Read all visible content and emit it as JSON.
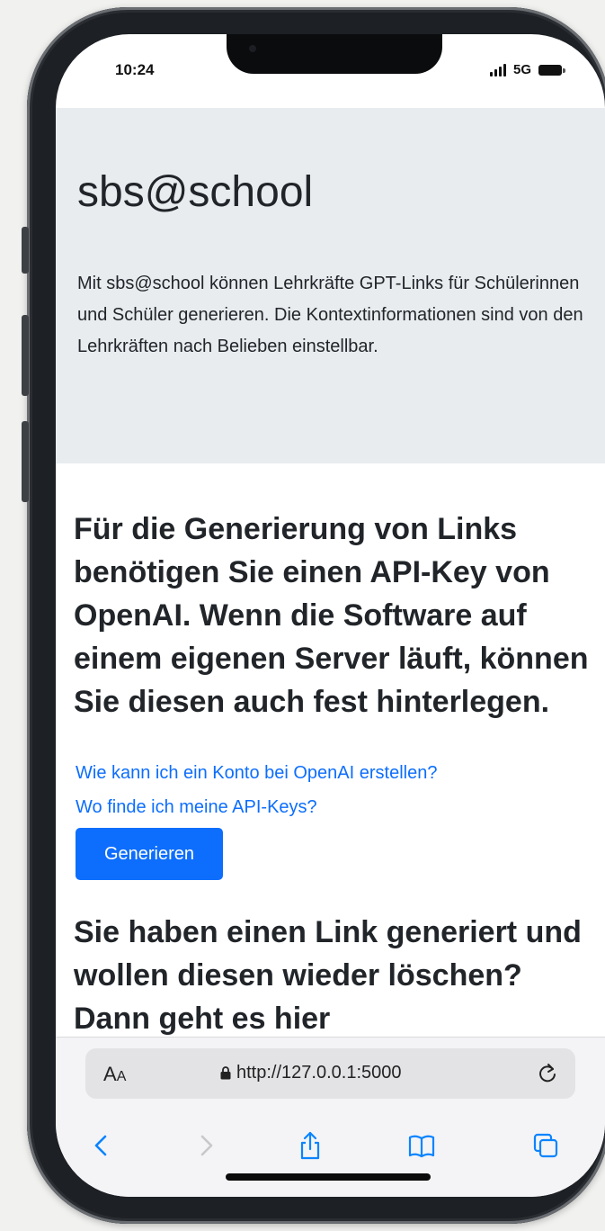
{
  "status_bar": {
    "time": "10:24",
    "network": "5G"
  },
  "hero": {
    "title": "sbs@school",
    "lead": "Mit sbs@school können Lehrkräfte GPT-Links für Schülerinnen und Schüler generieren. Die Kontextinformationen sind von den Lehrkräften nach Belieben einstellbar."
  },
  "info": {
    "heading": "Für die Generierung von Links benötigen Sie einen API-Key von OpenAI. Wenn die Software auf einem eigenen Server läuft, können Sie diesen auch fest hinterlegen.",
    "link_konto": "Wie kann ich ein Konto bei OpenAI erstellen?",
    "link_keys": "Wo finde ich meine API-Keys?",
    "generate_label": "Generieren"
  },
  "delete_section": {
    "heading": "Sie haben einen Link generiert und wollen diesen wieder löschen? Dann geht es hier"
  },
  "safari": {
    "aa_label_big": "A",
    "aa_label_small": "A",
    "url": "http://127.0.0.1:5000"
  },
  "colors": {
    "hero_bg": "#e9ecef",
    "link": "#0d6efd",
    "button": "#0d6efd",
    "toolbar_accent": "#0a84ff"
  },
  "icons": [
    "signal-icon",
    "battery-icon",
    "lock-icon",
    "reload-icon",
    "back-icon",
    "forward-icon",
    "share-icon",
    "bookmarks-icon",
    "tabs-icon"
  ]
}
